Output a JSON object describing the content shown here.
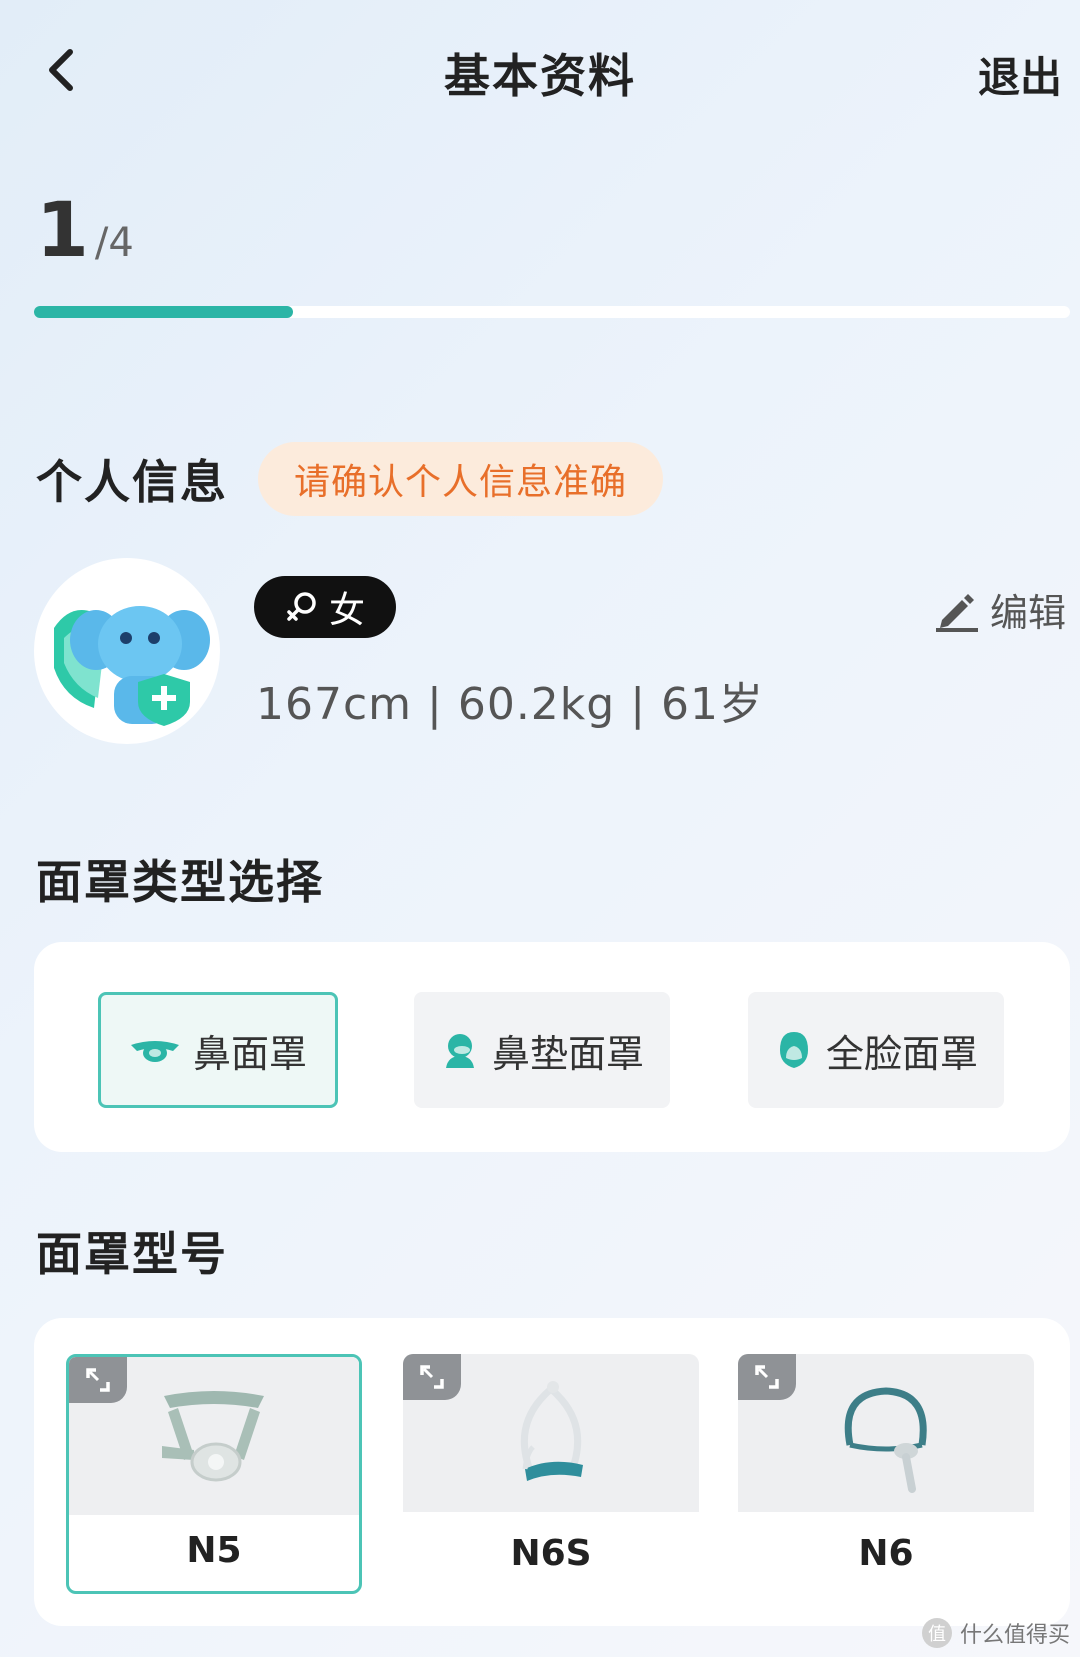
{
  "header": {
    "title": "基本资料",
    "exit_label": "退出",
    "back_icon": "chevron-left-icon"
  },
  "progress": {
    "current": "1",
    "total": "/4",
    "fraction": 0.25
  },
  "personal_info": {
    "section_title": "个人信息",
    "notice": "请确认个人信息准确",
    "gender": "女",
    "gender_icon": "female-icon",
    "metrics": "167cm | 60.2kg | 61岁",
    "edit_label": "编辑",
    "edit_icon": "pencil-icon"
  },
  "mask_type": {
    "section_title": "面罩类型选择",
    "options": [
      {
        "label": "鼻面罩",
        "icon": "nasal-mask-icon",
        "selected": true
      },
      {
        "label": "鼻垫面罩",
        "icon": "nasal-pillow-mask-icon",
        "selected": false
      },
      {
        "label": "全脸面罩",
        "icon": "full-face-mask-icon",
        "selected": false
      }
    ]
  },
  "mask_model": {
    "section_title": "面罩型号",
    "items": [
      {
        "name": "N5",
        "selected": true
      },
      {
        "name": "N6S",
        "selected": false
      },
      {
        "name": "N6",
        "selected": false
      }
    ]
  },
  "watermark": {
    "text": "什么值得买",
    "badge": "值"
  },
  "colors": {
    "accent": "#2bb5a6",
    "notice_bg": "#fcebdc",
    "notice_text": "#e86f2a",
    "selected_border": "#4cc4b6"
  }
}
